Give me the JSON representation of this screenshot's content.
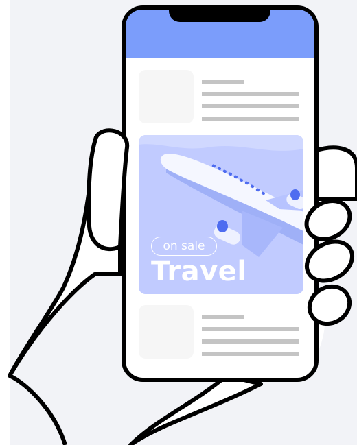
{
  "banner": {
    "tag": "on sale",
    "title": "Travel"
  },
  "colors": {
    "header": "#7b9dfb",
    "banner": "#c1cbff",
    "accent": "#4e6cf0",
    "background": "#f2f3f7",
    "placeholder_line": "#c4c4c4"
  },
  "icons": [
    "airplane-icon",
    "hand-icon",
    "phone-notch"
  ]
}
